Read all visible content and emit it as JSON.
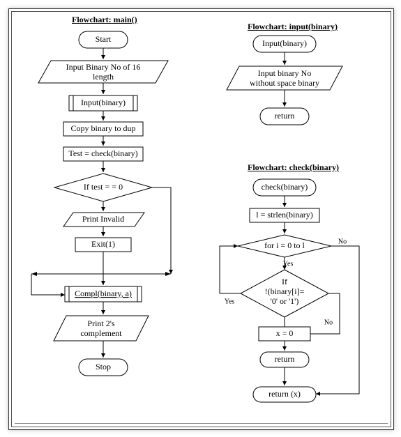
{
  "titles": {
    "main": "Flowchart: main()",
    "input": "Flowchart: input(binary)",
    "check": "Flowchart: check(binary)"
  },
  "main": {
    "start": "Start",
    "input_prompt_l1": "Input Binary No of  16",
    "input_prompt_l2": "length",
    "call_input": "Input(binary)",
    "copy": "Copy binary to dup",
    "test_assign": "Test = check(binary)",
    "decision": "If test = = 0",
    "invalid": "Print Invalid",
    "exit": "Exit(1)",
    "compl": "Compl(binary, a)",
    "print_l1": "Print 2's",
    "print_l2": "complement",
    "stop": "Stop"
  },
  "input": {
    "entry": "Input(binary)",
    "io_l1": "Input binary No",
    "io_l2": "without space binary",
    "return": "return"
  },
  "check": {
    "entry": "check(binary)",
    "len": "l = strlen(binary)",
    "loop": "for i = 0 to l",
    "yes": "Yes",
    "no": "No",
    "if_l1": "If",
    "if_l2": "!(binary[i]=",
    "if_l3": "'0' or '1')",
    "x0": "x = 0",
    "return": "return",
    "return_x": "return (x)"
  }
}
